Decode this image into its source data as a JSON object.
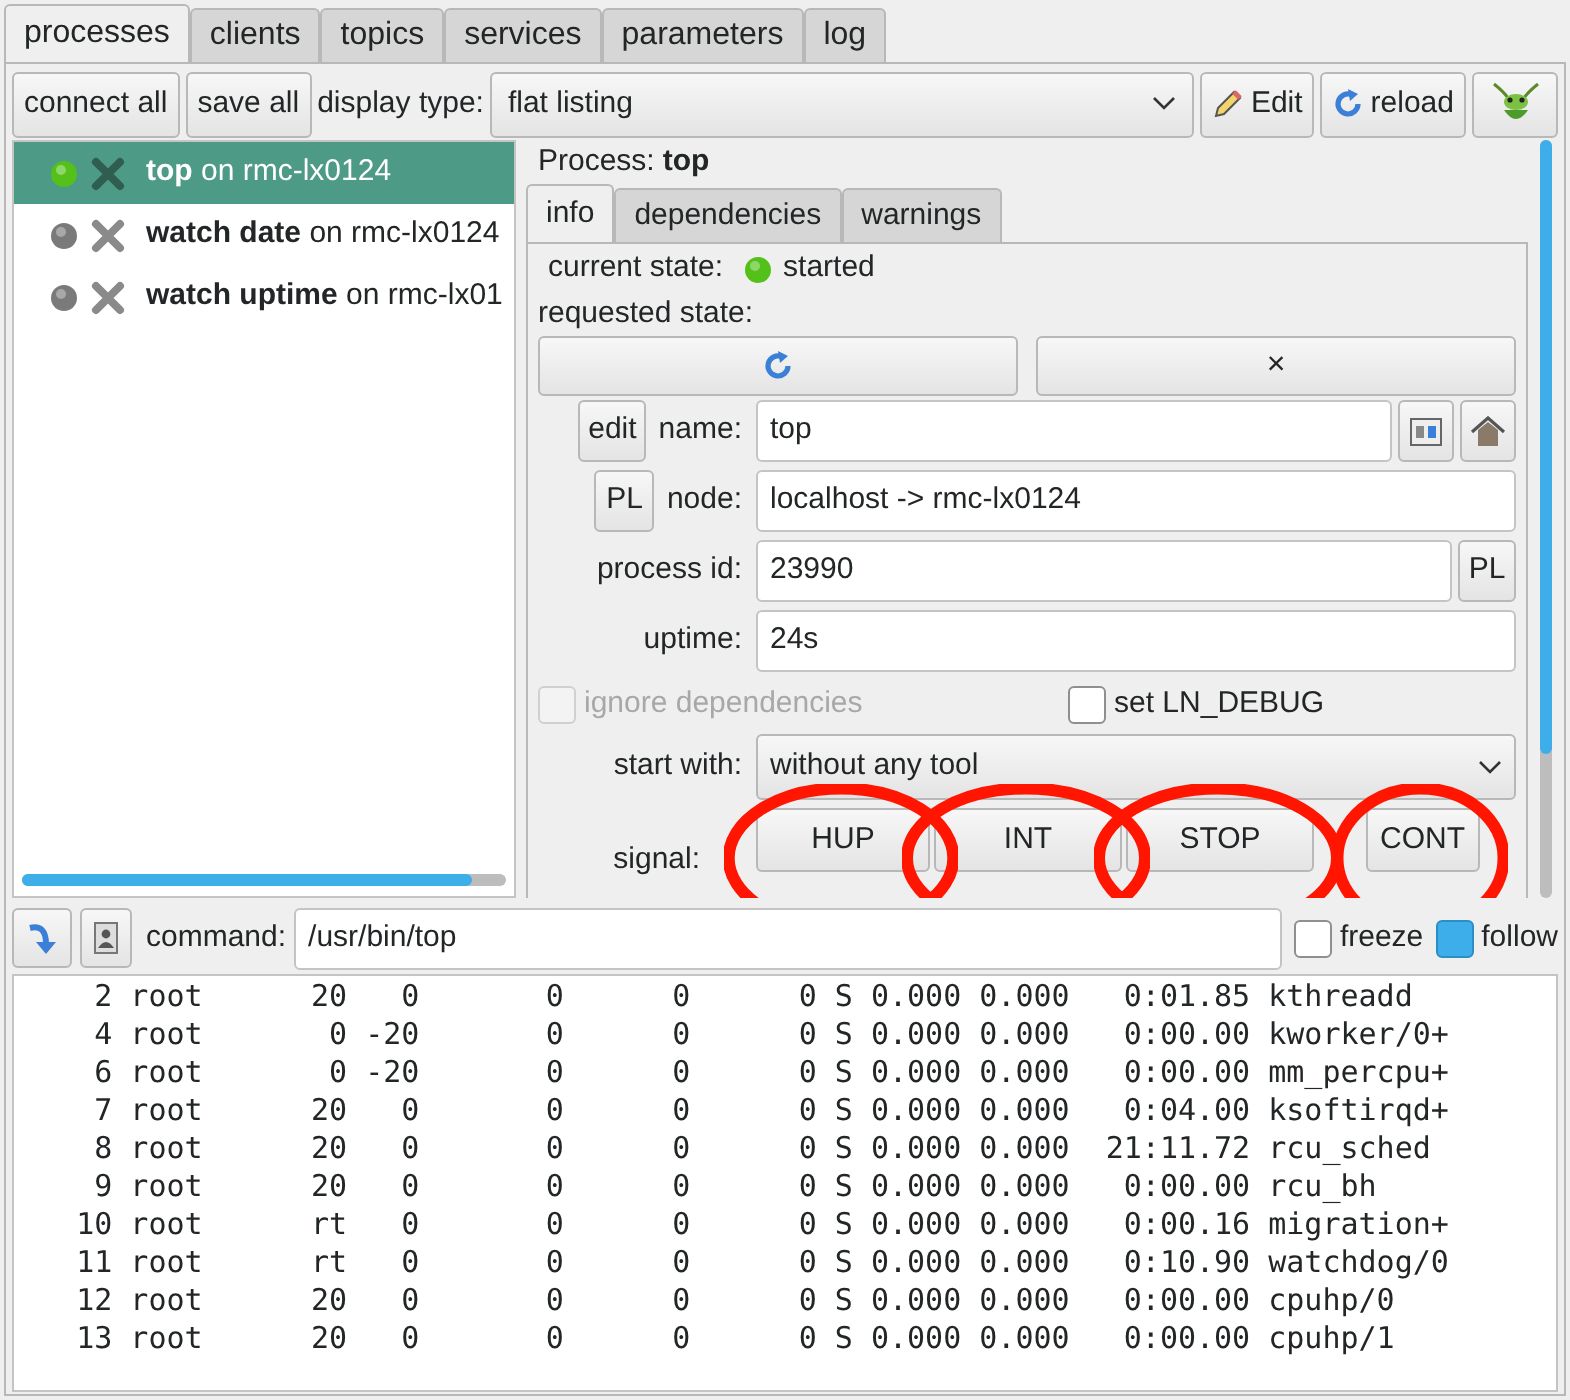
{
  "tabs": [
    {
      "label": "processes",
      "selected": true
    },
    {
      "label": "clients",
      "selected": false
    },
    {
      "label": "topics",
      "selected": false
    },
    {
      "label": "services",
      "selected": false
    },
    {
      "label": "parameters",
      "selected": false
    },
    {
      "label": "log",
      "selected": false
    }
  ],
  "toolbar": {
    "buttons": [
      "connect all",
      "save all"
    ],
    "display_type_label": "display type:",
    "display_type": "flat listing",
    "edit_button": "Edit",
    "reload_button": "reload"
  },
  "process_list": [
    {
      "text": "**top** on rmc-lx0124",
      "color": "#54c11a",
      "selected": true
    },
    {
      "text": "**watch date** on rmc-lx0124",
      "color": "#7a7a7a",
      "selected": false
    },
    {
      "text": "**watch uptime** on rmc-lx01",
      "color": "#7a7a7a",
      "selected": false
    }
  ],
  "details": {
    "title_label": "Process:",
    "title": "top",
    "tabs": [
      {
        "label": "info",
        "selected": true
      },
      {
        "label": "dependencies",
        "selected": false
      },
      {
        "label": "warnings",
        "selected": false
      }
    ],
    "current_state_label": "current state:",
    "current_state": {
      "label": "started",
      "color": "#54c11a"
    },
    "requested_state_label": "requested state:",
    "stop_button": "×",
    "edit_button": "edit",
    "name_label": "name:",
    "name": "top",
    "node_button": "PL",
    "node_label": "node:",
    "node": "localhost -> rmc-lx0124",
    "pid_label": "process id:",
    "pid": "23990",
    "pid_button": "PL",
    "uptime_label": "uptime:",
    "uptime": "24s",
    "ignore_dependencies": {
      "label": "ignore dependencies",
      "checked": false,
      "disabled": true
    },
    "set_ln_debug": {
      "label": "set LN_DEBUG",
      "checked": false,
      "disabled": false
    },
    "start_with_label": "start with:",
    "start_with": "without any tool",
    "signal_label": "signal:",
    "signals": [
      {
        "label": "HUP",
        "circled": true
      },
      {
        "label": "INT",
        "circled": true
      },
      {
        "label": "STOP",
        "circled": true
      },
      {
        "label": "CONT",
        "circled": true
      }
    ]
  },
  "command_bar": {
    "command_label": "command:",
    "command": "/usr/bin/top",
    "freeze": {
      "label": "freeze",
      "checked": false
    },
    "follow": {
      "label": "follow",
      "checked": true
    }
  },
  "output_lines": [
    "    2 root      20   0       0      0      0 S 0.000 0.000   0:01.85 kthreadd",
    "    4 root       0 -20       0      0      0 S 0.000 0.000   0:00.00 kworker/0+",
    "    6 root       0 -20       0      0      0 S 0.000 0.000   0:00.00 mm_percpu+",
    "    7 root      20   0       0      0      0 S 0.000 0.000   0:04.00 ksoftirqd+",
    "    8 root      20   0       0      0      0 S 0.000 0.000  21:11.72 rcu_sched",
    "    9 root      20   0       0      0      0 S 0.000 0.000   0:00.00 rcu_bh",
    "   10 root      rt   0       0      0      0 S 0.000 0.000   0:00.16 migration+",
    "   11 root      rt   0       0      0      0 S 0.000 0.000   0:10.90 watchdog/0",
    "   12 root      20   0       0      0      0 S 0.000 0.000   0:00.00 cpuhp/0",
    "   13 root      20   0       0      0      0 S 0.000 0.000   0:00.00 cpuhp/1"
  ]
}
